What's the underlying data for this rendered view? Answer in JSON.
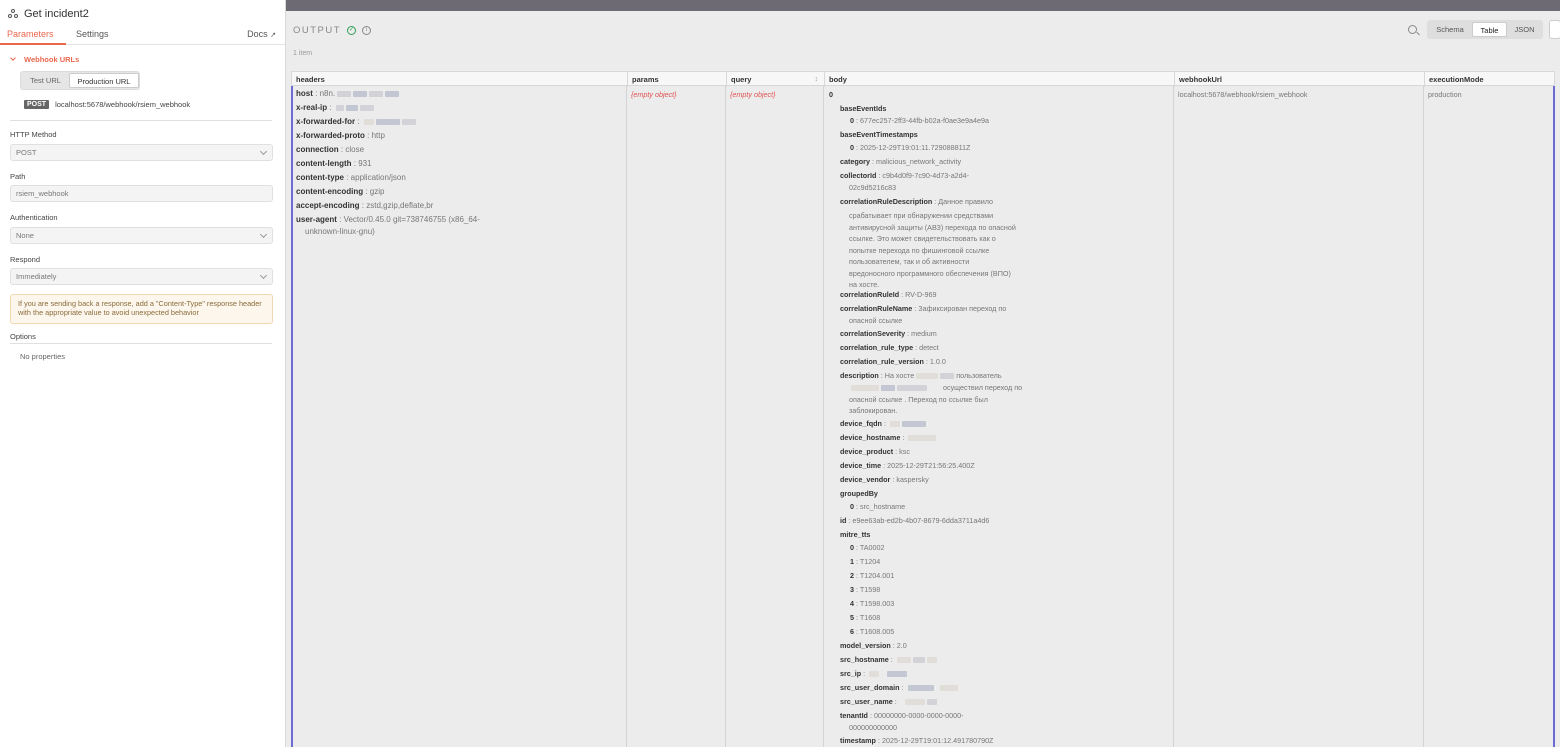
{
  "node": {
    "title": "Get incident2"
  },
  "tabs": {
    "parameters": "Parameters",
    "settings": "Settings",
    "docs": "Docs"
  },
  "webhook": {
    "section_label": "Webhook URLs",
    "test_url_tab": "Test URL",
    "production_url_tab": "Production URL",
    "method_badge": "POST",
    "url": "localhost:5678/webhook/rsiem_webhook"
  },
  "fields": {
    "http_method": {
      "label": "HTTP Method",
      "value": "POST"
    },
    "path": {
      "label": "Path",
      "value": "rsiem_webhook"
    },
    "authentication": {
      "label": "Authentication",
      "value": "None"
    },
    "respond": {
      "label": "Respond",
      "value": "Immediately"
    }
  },
  "notice": "If you are sending back a response, add a \"Content-Type\" response header with the appropriate value to avoid unexpected behavior",
  "options": {
    "label": "Options",
    "empty": "No properties"
  },
  "output": {
    "title": "OUTPUT",
    "item_count": "1 item",
    "views": {
      "schema": "Schema",
      "table": "Table",
      "json": "JSON"
    }
  },
  "table": {
    "columns": [
      "headers",
      "params",
      "query",
      "body",
      "webhookUrl",
      "executionMode"
    ],
    "params_value": "{empty object}",
    "query_value": "{empty object}",
    "webhook_url_value": "localhost:5678/webhook/rsiem_webhook",
    "execution_mode_value": "production",
    "headers": [
      {
        "key": "host",
        "value": "n8n."
      },
      {
        "key": "x-real-ip",
        "value": ""
      },
      {
        "key": "x-forwarded-for",
        "value": ""
      },
      {
        "key": "x-forwarded-proto",
        "value": "http"
      },
      {
        "key": "connection",
        "value": "close"
      },
      {
        "key": "content-length",
        "value": "931"
      },
      {
        "key": "content-type",
        "value": "application/json"
      },
      {
        "key": "content-encoding",
        "value": "gzip"
      },
      {
        "key": "accept-encoding",
        "value": "zstd,gzip,deflate,br"
      },
      {
        "key": "user-agent",
        "value": "Vector/0.45.0 git=738746755 (x86_64-",
        "value2": "unknown-linux-gnu)"
      }
    ],
    "body": {
      "index": "0",
      "baseEventIds_key": "baseEventIds",
      "baseEventIds_0": "677ec257-2ff3-44fb-b02a-f0ae3e9a4e9a",
      "baseEventTimestamps_key": "baseEventTimestamps",
      "baseEventTimestamps_0": "2025-12-29T19:01:11.729088811Z",
      "category": "malicious_network_activity",
      "collectorId_1": "c9b4d0f9-7c90-4d73-a2d4-",
      "collectorId_2": "02c9d5216c83",
      "correlationRuleDescription": [
        "Данное правило",
        "срабатывает при обнаружении средствами",
        "антивирусной защиты (АВЗ) перехода по опасной",
        "ссылке. Это может свидетельствовать как о",
        "попытке перехода по фишинговой ссылке",
        "пользователем, так и об активности",
        "вредоносного программного обеспечения (ВПО)",
        "на хосте."
      ],
      "correlationRuleId": "RV-D-969",
      "correlationRuleName_1": "Зафиксирован переход по",
      "correlationRuleName_2": "опасной ссылке",
      "correlationSeverity": "medium",
      "correlation_rule_type": "detect",
      "correlation_rule_version": "1.0.0",
      "description_1": "На хосте",
      "description_1b": "пользователь",
      "description_2": "осуществил переход по",
      "description_3": "опасной ссылке . Переход по ссылке был",
      "description_4": "заблокирован.",
      "device_fqdn": "",
      "device_hostname": "",
      "device_product": "ksc",
      "device_time": "2025-12-29T21:56:25.400Z",
      "device_vendor": "kaspersky",
      "groupedBy_key": "groupedBy",
      "groupedBy_0": "src_hostname",
      "id": "e9ee63ab-ed2b-4b07-8679-6dda3711a4d6",
      "mitre_tts_key": "mitre_tts",
      "mitre_tts": [
        "TA0002",
        "T1204",
        "T1204.001",
        "T1598",
        "T1598.003",
        "T1608",
        "T1608.005"
      ],
      "model_version": "2.0",
      "src_hostname": "",
      "src_ip": "",
      "src_user_domain": "",
      "src_user_name": "",
      "tenantId_1": "00000000-0000-0000-0000-",
      "tenantId_2": "000000000000",
      "timestamp": "2025-12-29T19:01:12.491780790Z"
    }
  }
}
